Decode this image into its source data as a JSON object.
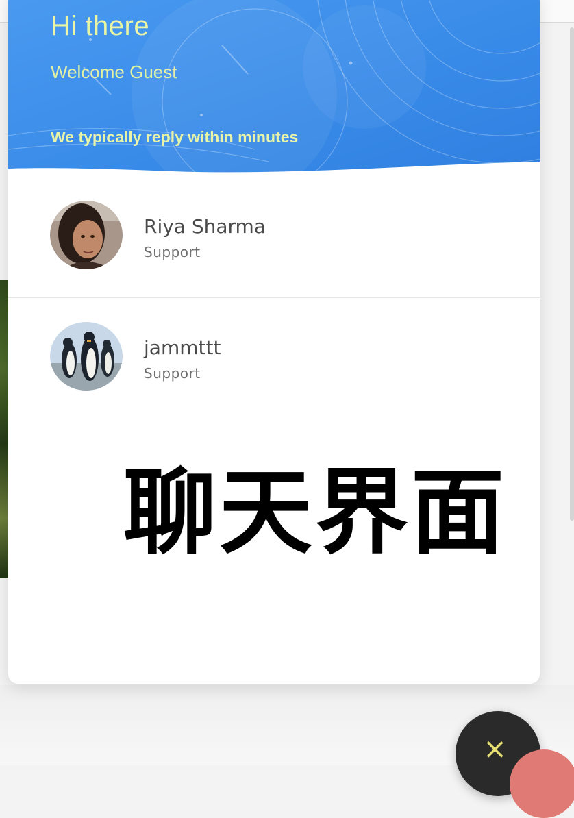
{
  "header": {
    "greeting": "Hi there",
    "welcome": "Welcome Guest",
    "reply_note": "We typically reply within minutes"
  },
  "agents": [
    {
      "name": "Riya Sharma",
      "role": "Support"
    },
    {
      "name": "jammttt",
      "role": "Support"
    }
  ],
  "overlay_caption": "聊天界面",
  "close_button": {
    "label": "×"
  },
  "colors": {
    "header_blue": "#3b8de8",
    "header_text": "#eaf6a6",
    "fab_dark": "#2a2a2a",
    "fab_close_x": "#e8e070",
    "fab_peek": "#e07a74"
  }
}
